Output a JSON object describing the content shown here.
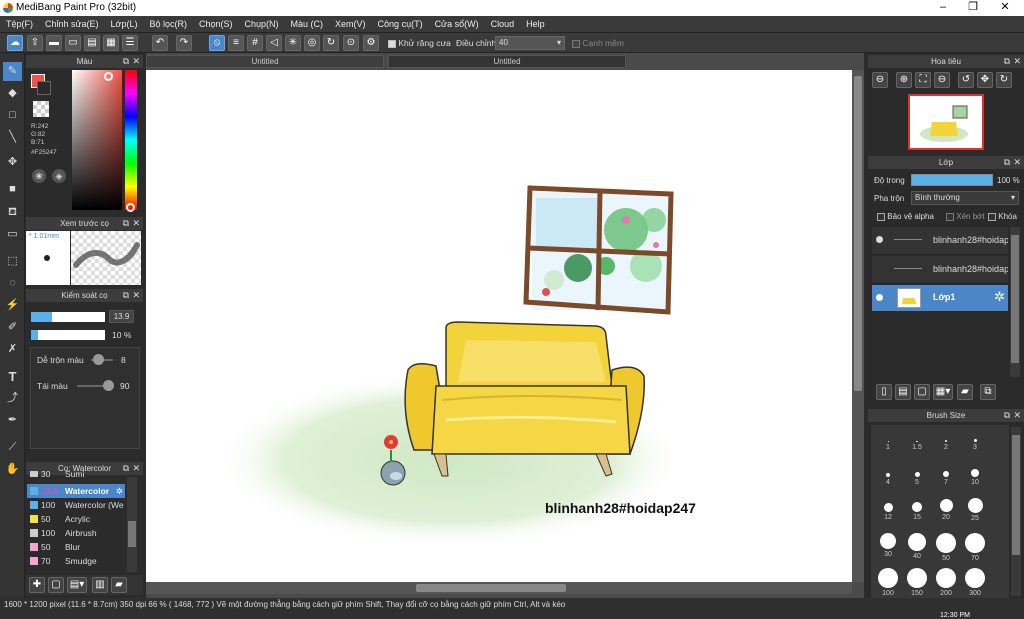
{
  "app": {
    "title": "MediBang Paint Pro (32bit)"
  },
  "menu": [
    "Tệp(F)",
    "Chỉnh sửa(E)",
    "Lớp(L)",
    "Bộ lọc(R)",
    "Chọn(S)",
    "Chụp(N)",
    "Màu (C)",
    "Xem(V)",
    "Công cụ(T)",
    "Cửa sổ(W)",
    "Cloud",
    "Help"
  ],
  "toolbar": {
    "antialias_label": "Khử răng cưa",
    "adjust_label": "Điều chỉnh",
    "adjust_value": "40",
    "edge_label": "Cạnh mềm"
  },
  "color_panel": {
    "title": "Màu",
    "r": "R:242",
    "g": "G:82",
    "b": "B:71",
    "hex": "#F25247",
    "fg_color": "#F25247"
  },
  "preview_panel": {
    "title": "Xem trước cọ",
    "size": "* 1.01mm"
  },
  "brush_control": {
    "title": "Kiểm soát cọ",
    "size_value": "13.9",
    "opacity_value": "10 %",
    "blend_label": "Dễ trộn màu",
    "blend_value": "8",
    "pressure_label": "Tái màu",
    "pressure_value": "90",
    "size_fill": 0.28,
    "opacity_fill": 0.1
  },
  "brush_list": {
    "title": "Cọ: Watercolor",
    "items": [
      {
        "num": "30",
        "name": "Sumi",
        "color": "#cccccc"
      },
      {
        "num": "13.9",
        "name": "Watercolor",
        "color": "#5ab0e8"
      },
      {
        "num": "100",
        "name": "Watercolor (We",
        "color": "#5ab0e8"
      },
      {
        "num": "50",
        "name": "Acrylic",
        "color": "#f3e34a"
      },
      {
        "num": "100",
        "name": "Airbrush",
        "color": "#cccccc"
      },
      {
        "num": "50",
        "name": "Blur",
        "color": "#f5a6d0"
      },
      {
        "num": "70",
        "name": "Smudge",
        "color": "#f5a6d0"
      }
    ]
  },
  "tabs": [
    "Untitled",
    "Untitled"
  ],
  "canvas": {
    "watermark": "blinhanh28#hoidap247"
  },
  "navigator": {
    "title": "Hoa tiêu"
  },
  "layers": {
    "title": "Lớp",
    "opacity_label": "Độ trong",
    "opacity_value": "100 %",
    "blend_label": "Pha trộn",
    "blend_value": "Bình thường",
    "protect_label": "Bảo vệ alpha",
    "clip_label": "Xén bớt",
    "lock_label": "Khóa",
    "items": [
      {
        "name": "blinhanh28#hoidap"
      },
      {
        "name": "blinhanh28#hoidap"
      },
      {
        "name": "Lớp1"
      }
    ]
  },
  "brush_size": {
    "title": "Brush Size",
    "sizes": [
      "1",
      "1.5",
      "2",
      "3",
      "4",
      "5",
      "7",
      "10",
      "12",
      "15",
      "20",
      "25",
      "30",
      "40",
      "50",
      "70",
      "100",
      "150",
      "200",
      "300"
    ]
  },
  "status": {
    "text": "1600 * 1200 pixel   (11.6 * 8.7cm)  350 dpi   66 %   ( 1468, 772 )   Vẽ một đường thẳng bằng cách giữ phím Shift, Thay đổi cỡ cọ bằng cách giữ phím Ctrl, Alt và kéo",
    "clock": "12:30 PM"
  }
}
